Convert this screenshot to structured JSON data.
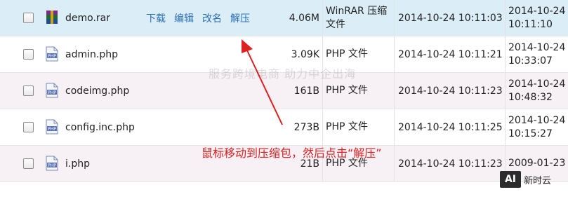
{
  "files": [
    {
      "name": "demo.rar",
      "icon": "rar-archive-icon",
      "size": "4.06M",
      "type": "WinRAR 压缩文件",
      "created": "2014-10-24 10:11:03",
      "modified": "2014-10-24 10:11:10",
      "selected": true
    },
    {
      "name": "admin.php",
      "icon": "php-file-icon",
      "size": "3.09K",
      "type": "PHP 文件",
      "created": "2014-10-24 10:11:21",
      "modified": "2014-10-24 10:33:07"
    },
    {
      "name": "codeimg.php",
      "icon": "php-file-icon",
      "size": "161B",
      "type": "PHP 文件",
      "created": "2014-10-24 10:11:23",
      "modified": "2014-10-24 10:48:32"
    },
    {
      "name": "config.inc.php",
      "icon": "php-file-icon",
      "size": "273B",
      "type": "PHP 文件",
      "created": "2014-10-24 10:11:25",
      "modified": "2014-10-24 10:15:27"
    },
    {
      "name": "i.php",
      "icon": "php-file-icon",
      "size": "21B",
      "type": "PHP 文件",
      "created": "2014-10-24 10:11:23",
      "modified": "2009-01-23"
    }
  ],
  "actions": {
    "download": "下载",
    "edit": "编辑",
    "rename": "改名",
    "extract": "解压"
  },
  "watermark_text": "服务跨境电商 助力中企出海",
  "annotation": "鼠标移动到压缩包，然后点击“解压”",
  "badge": {
    "box": "AI",
    "text": "新时云"
  },
  "colors": {
    "selected_row": "#dbeef8",
    "alt_row": "#f7f0f4",
    "link": "#2b6fb8",
    "annotation": "#e02020"
  }
}
